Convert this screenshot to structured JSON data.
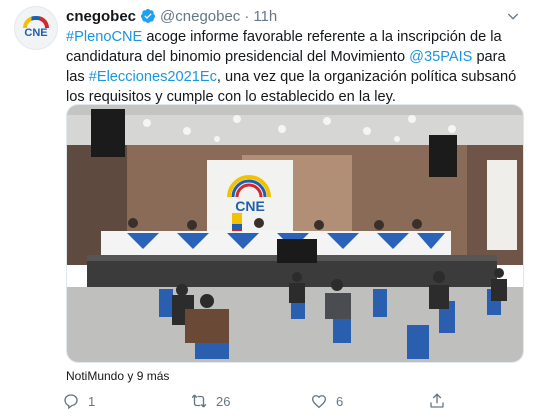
{
  "account": {
    "name": "cnegobec",
    "handle": "@cnegobec",
    "separator": "·",
    "time": "11h",
    "avatar_text": "CNE"
  },
  "tweet": {
    "segments": [
      {
        "text": "#PlenoCNE",
        "link": true
      },
      {
        "text": " acoge informe favorable referente a la inscripción de la candidatura del binomio presidencial del Movimiento ",
        "link": false
      },
      {
        "text": "@35PAIS",
        "link": true
      },
      {
        "text": " para las ",
        "link": false
      },
      {
        "text": "#Elecciones2021Ec",
        "link": true
      },
      {
        "text": ", una vez que la organización política subsanó los requisitos y cumple con lo establecido en la ley.",
        "link": false
      }
    ]
  },
  "photo": {
    "wall_logo_text": "CNE",
    "tag_caption": "NotiMundo y 9 más"
  },
  "actions": {
    "reply_count": "1",
    "retweet_count": "26",
    "like_count": "6"
  },
  "icons": [
    "verified-icon",
    "caret-down-icon",
    "reply-icon",
    "retweet-icon",
    "like-icon",
    "share-icon"
  ],
  "colors": {
    "link": "#1b95e0",
    "verified": "#1da1f2",
    "muted": "#657786",
    "table_banner": "#2a63b8"
  }
}
